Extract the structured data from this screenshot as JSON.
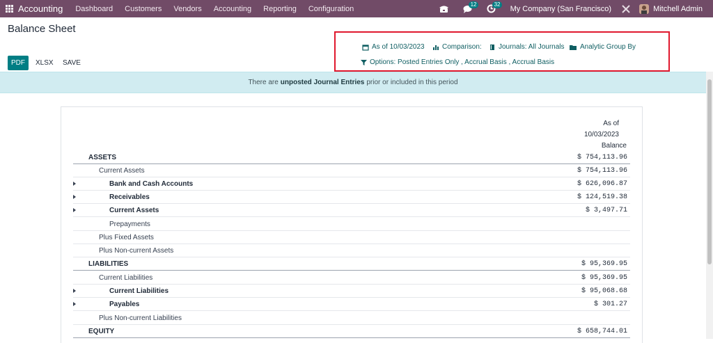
{
  "navbar": {
    "app_name": "Accounting",
    "menus": [
      "Dashboard",
      "Customers",
      "Vendors",
      "Accounting",
      "Reporting",
      "Configuration"
    ],
    "messages_badge": "12",
    "activity_badge": "32",
    "company": "My Company (San Francisco)",
    "user": "Mitchell Admin"
  },
  "control": {
    "title": "Balance Sheet",
    "pdf_label": "PDF",
    "xlsx_label": "XLSX",
    "save_label": "SAVE",
    "filters": {
      "date": "As of 10/03/2023",
      "comparison": "Comparison:",
      "journals": "Journals: All Journals",
      "analytic": "Analytic Group By",
      "options": "Options: Posted Entries Only , Accrual Basis , Accrual Basis"
    }
  },
  "banner": {
    "prefix": "There are",
    "strong": "unposted Journal Entries",
    "suffix": "prior or included in this period"
  },
  "report": {
    "header_line1": "As of",
    "header_line2": "10/03/2023",
    "header_line3": "Balance",
    "rows": [
      {
        "label": "ASSETS",
        "amount": "$ 754,113.96"
      },
      {
        "label": "Current Assets",
        "amount": "$ 754,113.96"
      },
      {
        "label": "Bank and Cash Accounts",
        "amount": "$ 626,096.87"
      },
      {
        "label": "Receivables",
        "amount": "$ 124,519.38"
      },
      {
        "label": "Current Assets",
        "amount": "$ 3,497.71"
      },
      {
        "label": "Prepayments",
        "amount": ""
      },
      {
        "label": "Plus Fixed Assets",
        "amount": ""
      },
      {
        "label": "Plus Non-current Assets",
        "amount": ""
      },
      {
        "label": "LIABILITIES",
        "amount": "$ 95,369.95"
      },
      {
        "label": "Current Liabilities",
        "amount": "$ 95,369.95"
      },
      {
        "label": "Current Liabilities",
        "amount": "$ 95,068.68"
      },
      {
        "label": "Payables",
        "amount": "$ 301.27"
      },
      {
        "label": "Plus Non-current Liabilities",
        "amount": ""
      },
      {
        "label": "EQUITY",
        "amount": "$ 658,744.01"
      }
    ]
  }
}
